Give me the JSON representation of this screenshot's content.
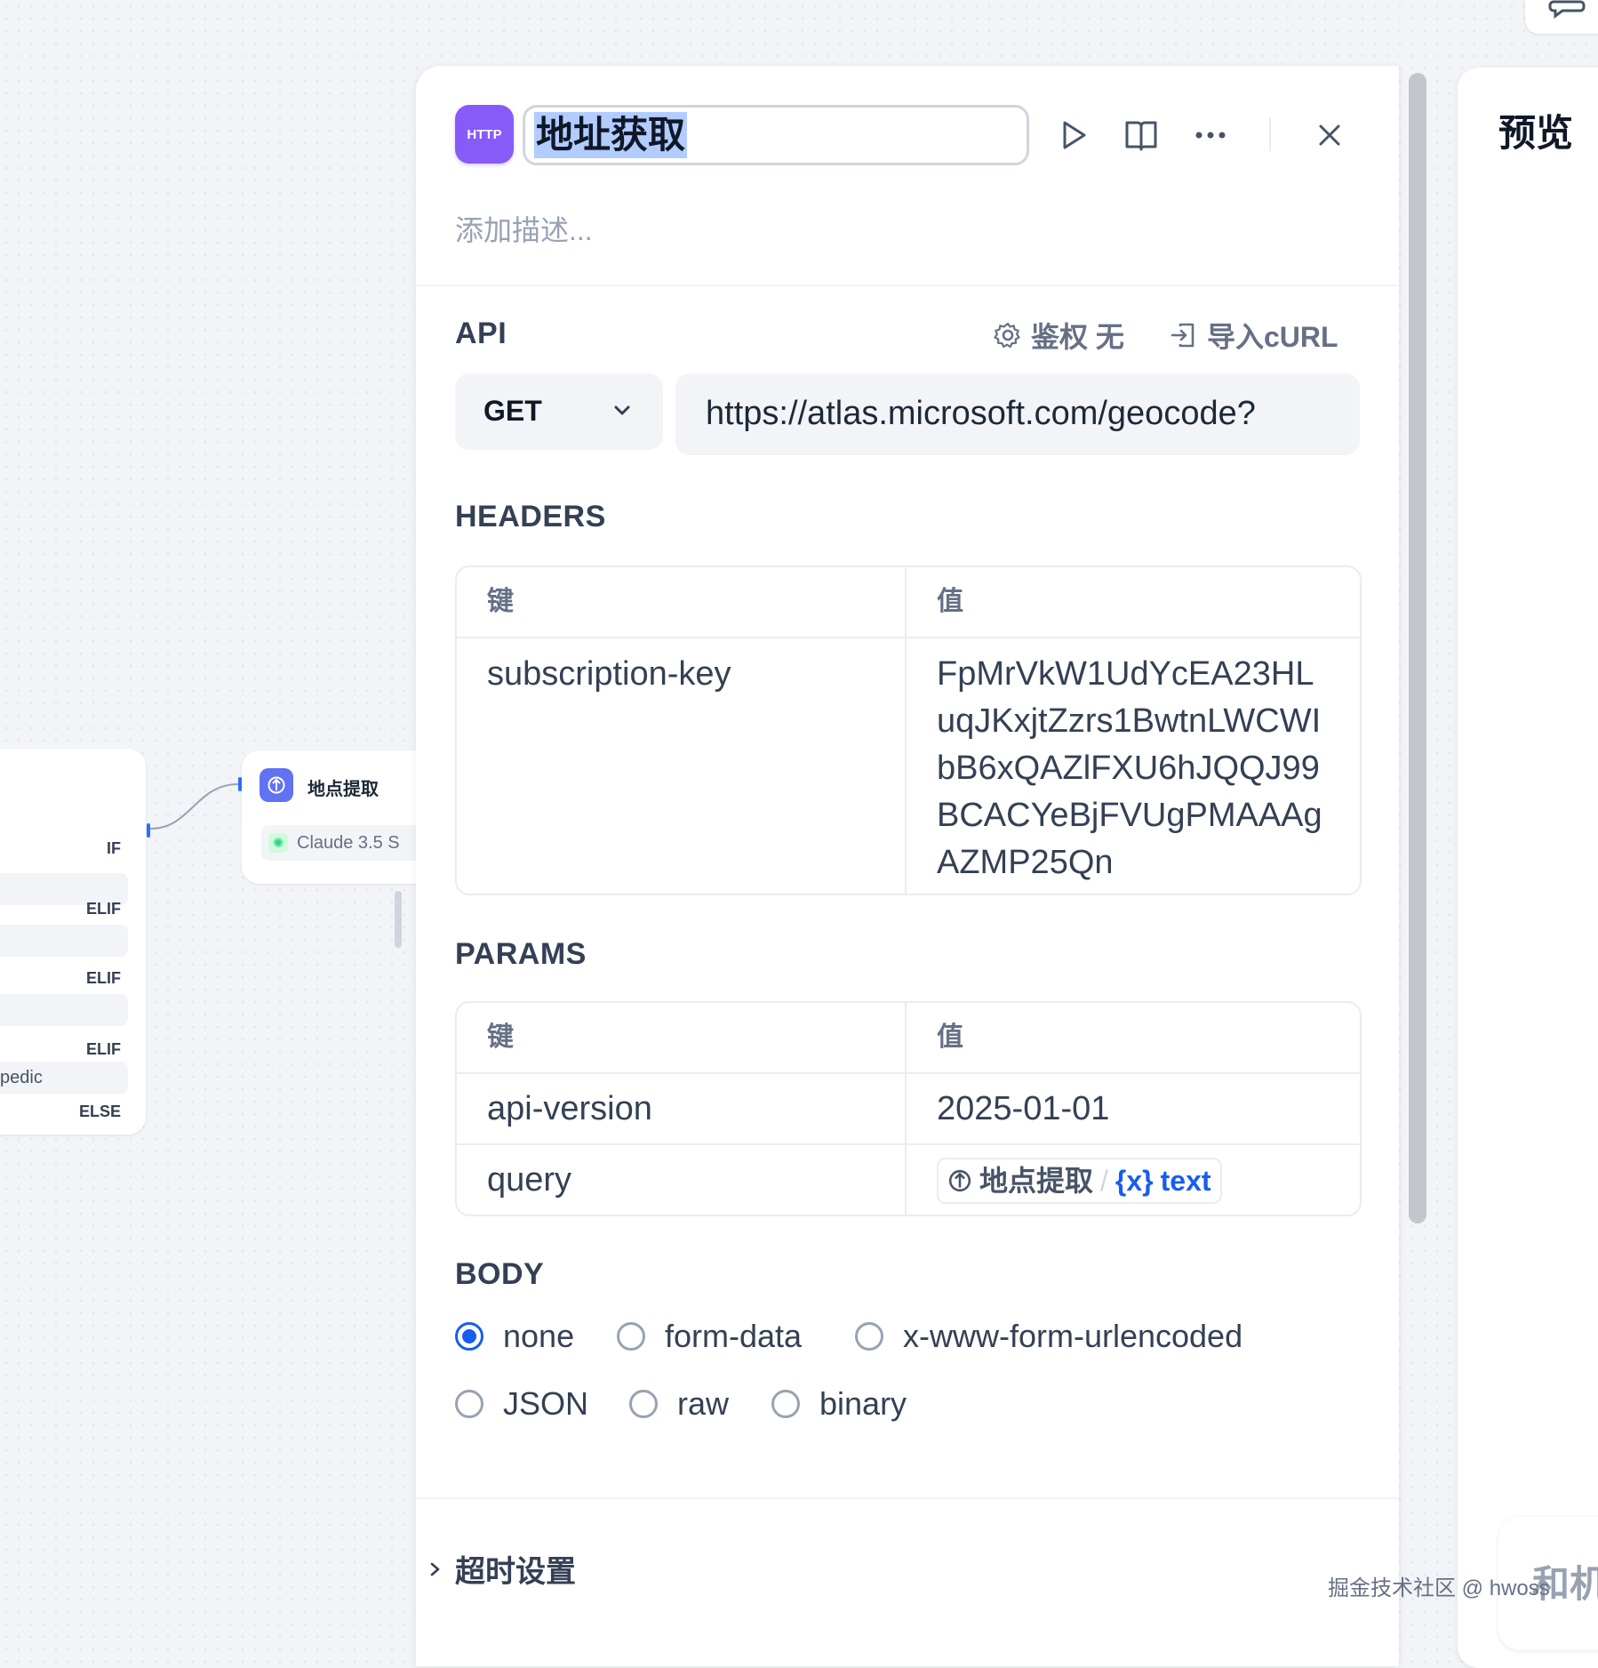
{
  "canvas": {
    "if_node": {
      "cases": [
        "IF",
        "ELIF",
        "ELIF",
        "ELIF",
        "ELSE"
      ],
      "condition_partial": "pedic"
    },
    "llm_node": {
      "title": "地点提取",
      "model": "Claude 3.5 S"
    }
  },
  "panel": {
    "icon_label": "HTTP",
    "title": "地址获取",
    "description_placeholder": "添加描述...",
    "header_icons": [
      "play-icon",
      "book-icon",
      "more-icon",
      "close-icon"
    ],
    "api": {
      "label": "API",
      "auth_label": "鉴权 无",
      "import_label": "导入cURL",
      "method": "GET",
      "url": "https://atlas.microsoft.com/geocode?"
    },
    "headers": {
      "label": "HEADERS",
      "key_header": "键",
      "value_header": "值",
      "rows": [
        {
          "key": "subscription-key",
          "value": "FpMrVkW1UdYcEA23HLuqJKxjtZzrs1BwtnLWCWIbB6xQAZlFXU6hJQQJ99BCACYeBjFVUgPMAAAgAZMP25Qn"
        }
      ]
    },
    "params": {
      "label": "PARAMS",
      "key_header": "键",
      "value_header": "值",
      "rows": [
        {
          "key": "api-version",
          "value": "2025-01-01"
        },
        {
          "key": "query",
          "var_node": "地点提取",
          "var_name": "text"
        }
      ]
    },
    "body": {
      "label": "BODY",
      "options": [
        "none",
        "form-data",
        "x-www-form-urlencoded",
        "JSON",
        "raw",
        "binary"
      ],
      "selected": "none"
    },
    "timeout_label": "超时设置"
  },
  "preview": {
    "title": "预览",
    "bottom_partial": "和机"
  },
  "watermark": "掘金技术社区 @ hwoss",
  "colors": {
    "accent": "#155eef",
    "http_icon": "#875bf7",
    "llm_icon": "#6172f3",
    "title_highlight": "#b2ccff"
  }
}
